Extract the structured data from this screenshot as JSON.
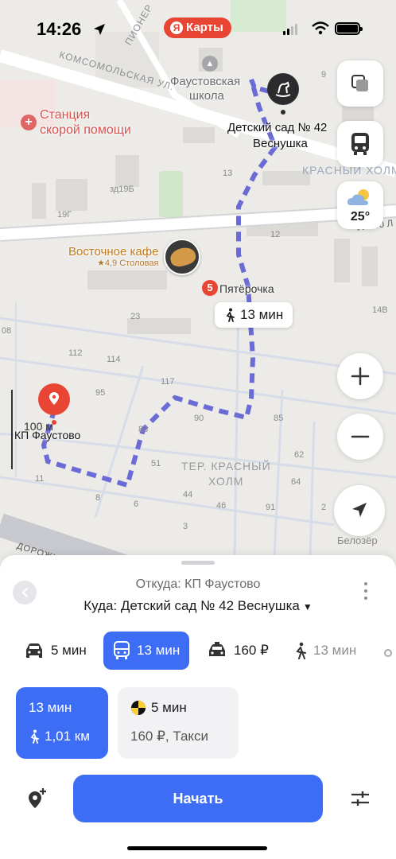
{
  "status_bar": {
    "time": "14:26",
    "brand": "Карты",
    "brand_logo": "Я"
  },
  "map": {
    "streets": [
      "КОМСОМОЛЬСКАЯ УЛ.",
      "ПИОНЕР",
      "УЛ. 50 Л",
      "ДОРОЖНА",
      "ТЕР. КРАСНЫЙ",
      "ХОЛМ",
      "КРАСНЫЙ ХОЛМ"
    ],
    "places": {
      "school": [
        "Фаустовская",
        "школа"
      ],
      "ambulance": [
        "Станция",
        "скорой помощи"
      ],
      "kindergarten": [
        "Детский сад № 42",
        "Веснушка"
      ],
      "cafe_name": "Восточное кафе",
      "cafe_sub": "★4,9 Столовая",
      "shop": "Пятёрочка",
      "origin": "КП Фаустово",
      "belozer": "Белозёр"
    },
    "house_numbers": [
      "9",
      "13",
      "12",
      "19Г",
      "зд19Б",
      "23",
      "112",
      "114",
      "117",
      "95",
      "90",
      "85",
      "83",
      "51",
      "62",
      "64",
      "44",
      "46",
      "91",
      "11",
      "8",
      "6",
      "3",
      "14В",
      "08",
      "2"
    ],
    "scale": "100 м",
    "walk_badge": "13 мин",
    "weather_temp": "25°",
    "route_color": "#6b6bd6"
  },
  "sheet": {
    "from": "Откуда: КП Фаустово",
    "to": "Куда: Детский сад № 42 Веснушка",
    "modes": [
      {
        "icon": "car-icon",
        "label": "5 мин"
      },
      {
        "icon": "bus-icon",
        "label": "13 мин"
      },
      {
        "icon": "taxi-icon",
        "label": "160 ₽"
      },
      {
        "icon": "walk-icon",
        "label": "13 мин"
      }
    ],
    "card_active": {
      "time": "13 мин",
      "distance": "1,01 км"
    },
    "card_taxi": {
      "time": "5 мин",
      "price": "160 ₽, Такси"
    },
    "start_label": "Начать"
  },
  "colors": {
    "accent": "#3d6cf5",
    "pin_red": "#e84534"
  }
}
